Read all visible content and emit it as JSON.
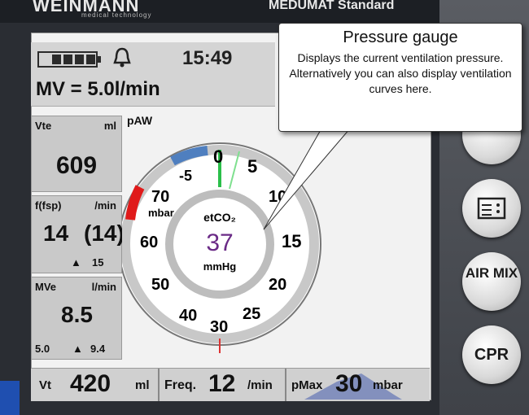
{
  "header": {
    "brand": "WEINMANN",
    "brand_sub": "medical technology",
    "model": "MEDUMAT Standard"
  },
  "status": {
    "time": "15:49",
    "mv": "MV = 5.0l/min"
  },
  "params": {
    "vte": {
      "label": "Vte",
      "unit": "ml",
      "value": "609"
    },
    "freq": {
      "label": "f(fsp)",
      "unit": "/min",
      "value": "14",
      "set": "(14)",
      "alarm": "15"
    },
    "mve": {
      "label": "MVe",
      "unit": "l/min",
      "value": "8.5",
      "low": "5.0",
      "high": "9.4"
    }
  },
  "gauge": {
    "label": "pAW",
    "unit": "mbar",
    "inner_label": "etCO₂",
    "inner_value": "37",
    "inner_unit": "mmHg",
    "scale_labels": [
      "-5",
      "0",
      "5",
      "10",
      "15",
      "20",
      "25",
      "30",
      "40",
      "50",
      "60",
      "70"
    ],
    "current_pressure": 0
  },
  "bottom": {
    "vt_label": "Vt",
    "vt_value": "420",
    "vt_unit": "ml",
    "freq_label": "Freq.",
    "freq_value": "12",
    "freq_unit": "/min",
    "pmax_label": "pMax",
    "pmax_value": "30",
    "pmax_unit": "mbar"
  },
  "right_buttons": [
    "AIR MIX",
    "CPR"
  ],
  "callout": {
    "title": "Pressure gauge",
    "body": "Displays the current ventilation pressure. Alternatively you can also display ventilation curves here."
  }
}
